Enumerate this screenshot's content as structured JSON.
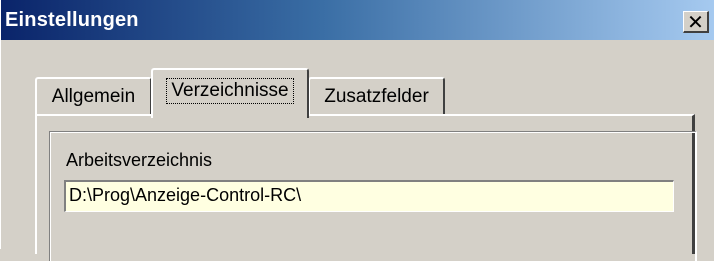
{
  "window": {
    "title": "Einstellungen",
    "close_symbol": "✕"
  },
  "tabs": [
    {
      "label": "Allgemein",
      "selected": false
    },
    {
      "label": "Verzeichnisse",
      "selected": true
    },
    {
      "label": "Zusatzfelder",
      "selected": false
    }
  ],
  "panel": {
    "field_label": "Arbeitsverzeichnis",
    "field_value": "D:\\Prog\\Anzeige-Control-RC\\"
  },
  "colors": {
    "title_start": "#0a246a",
    "title_end": "#a6caf0",
    "input_background": "#ffffe1",
    "dialog_background": "#d4d0c8"
  },
  "icons": {
    "close": "close-icon"
  }
}
